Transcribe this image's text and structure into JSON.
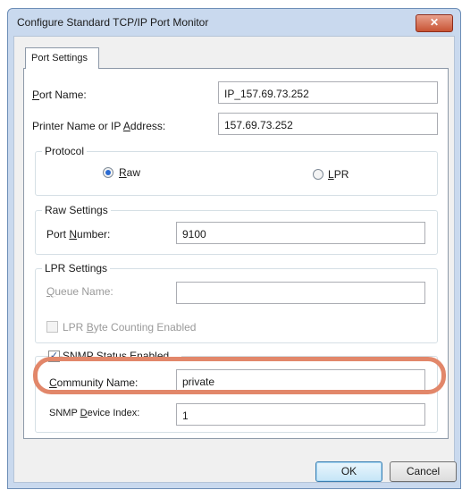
{
  "window": {
    "title": "Configure Standard TCP/IP Port Monitor",
    "close_glyph": "✕"
  },
  "tabs": [
    {
      "label": "Port Settings"
    }
  ],
  "port_name": {
    "label": "Port Name:",
    "value": "IP_157.69.73.252"
  },
  "printer_address": {
    "label": "Printer Name or IP Address:",
    "value": "157.69.73.252"
  },
  "protocol": {
    "group_label": "Protocol",
    "options": [
      {
        "label": "Raw",
        "selected": true
      },
      {
        "label": "LPR",
        "selected": false
      }
    ]
  },
  "raw_settings": {
    "group_label": "Raw Settings",
    "port_number_label": "Port Number:",
    "port_number_value": "9100"
  },
  "lpr_settings": {
    "group_label": "LPR Settings",
    "queue_name_label": "Queue Name:",
    "queue_name_value": "",
    "byte_counting_label": "LPR Byte Counting Enabled",
    "byte_counting_checked": false
  },
  "snmp": {
    "enabled_label": "SNMP Status Enabled",
    "enabled_checked": true,
    "community_label": "Community Name:",
    "community_value": "private",
    "device_index_label": "SNMP Device Index:",
    "device_index_value": "1"
  },
  "buttons": {
    "ok": "OK",
    "cancel": "Cancel"
  },
  "colors": {
    "highlight": "#e2876a",
    "titlebar": "#c9d9ee",
    "close": "#c85434"
  }
}
